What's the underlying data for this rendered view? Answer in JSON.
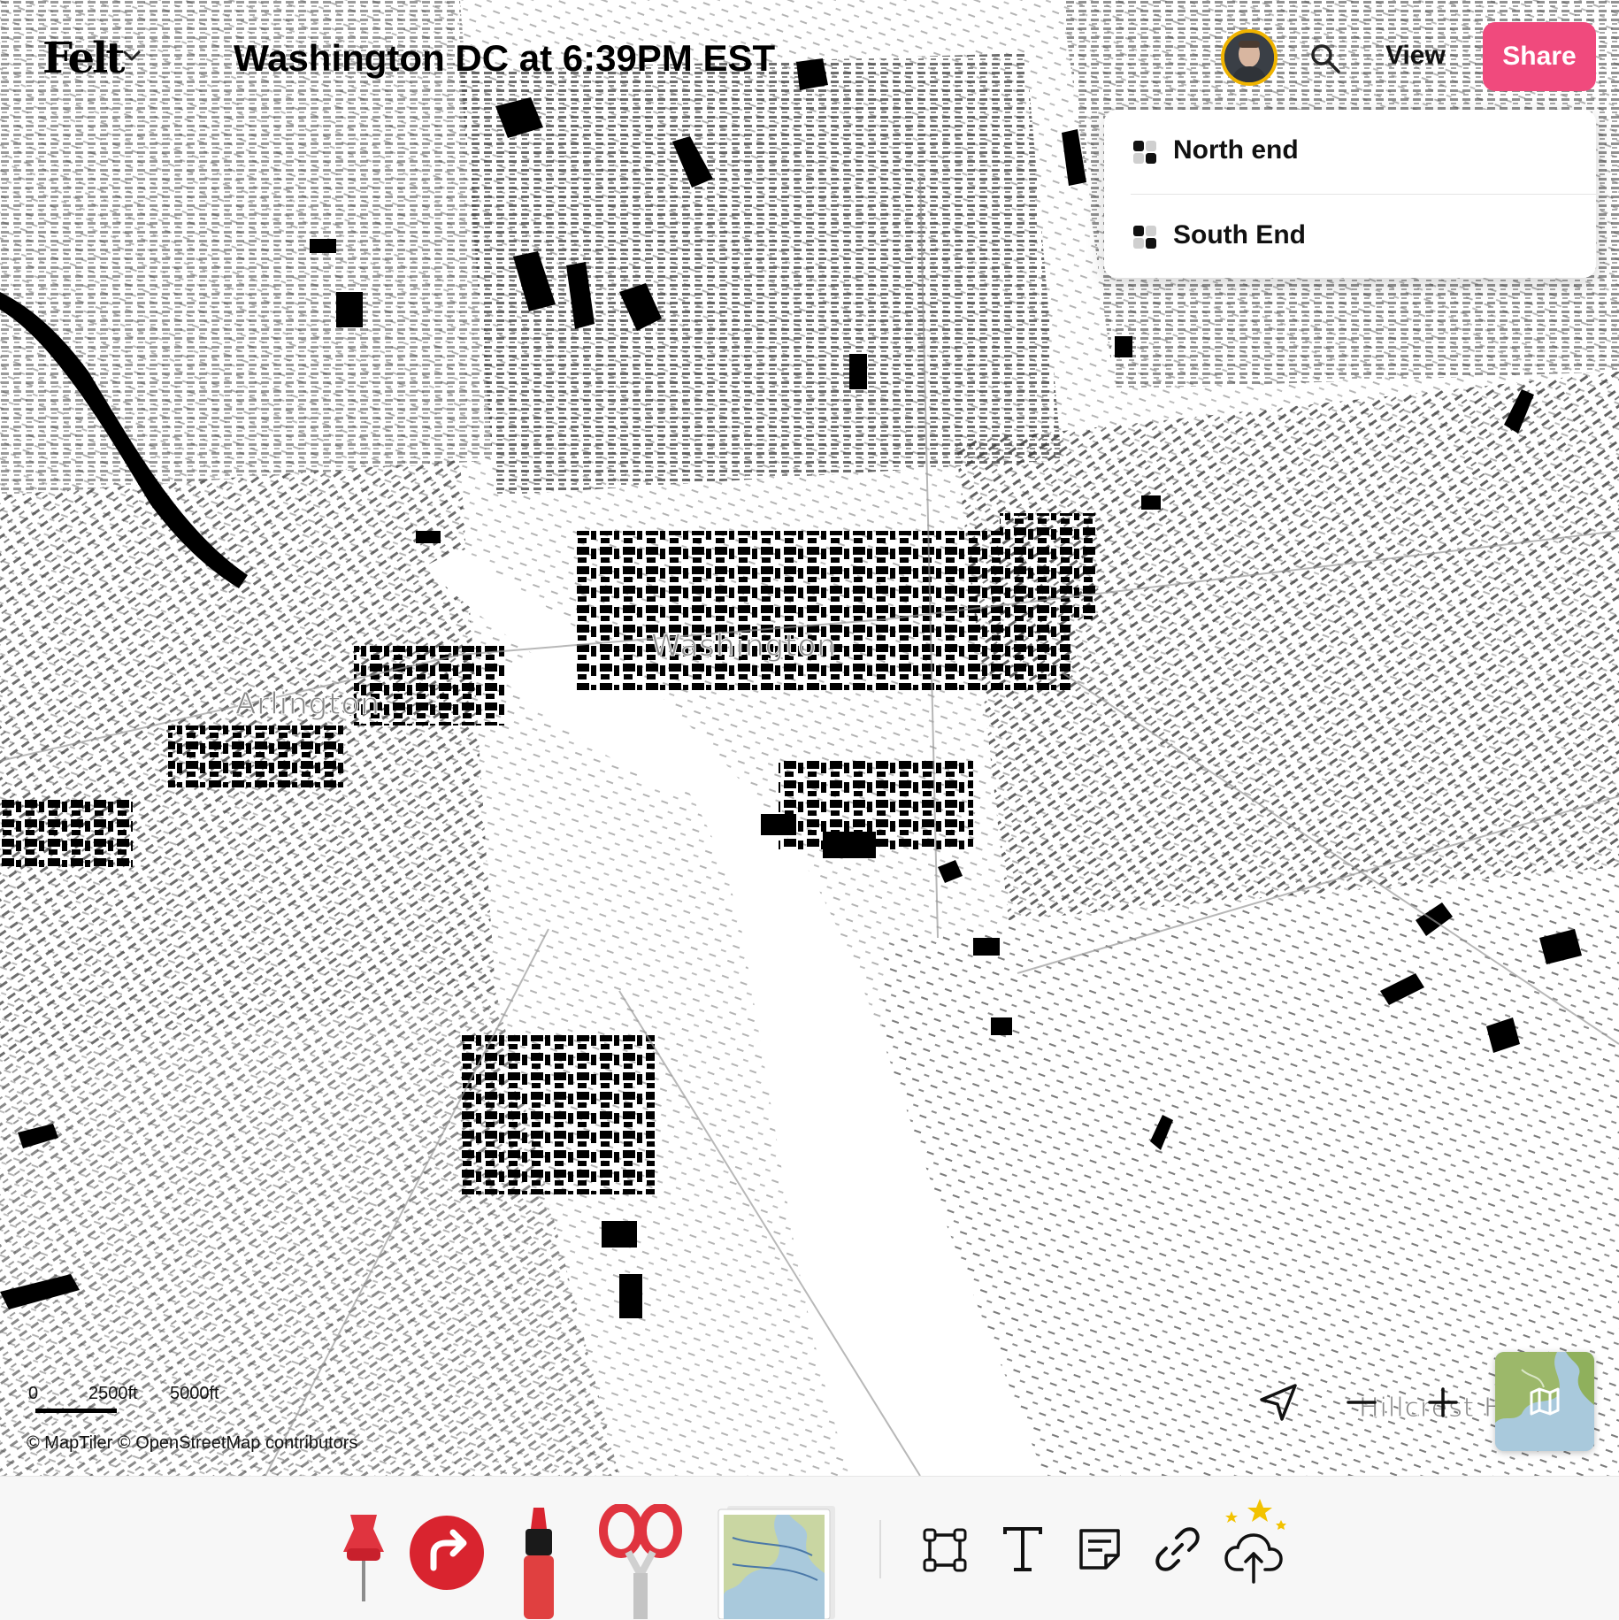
{
  "header": {
    "logo": "Felt",
    "map_title": "Washington DC at 6:39PM EST",
    "view_label": "View",
    "share_label": "Share"
  },
  "view_menu": {
    "items": [
      {
        "label": "North end"
      },
      {
        "label": "South End"
      }
    ]
  },
  "map": {
    "place_labels": [
      "Washington",
      "Arlington",
      "Hillcrest H"
    ],
    "scale_labels": [
      "0",
      "2500ft",
      "5000ft"
    ],
    "attribution": "© MapTiler  © OpenStreetMap contributors"
  },
  "icons": {
    "logo_menu": "chevron-down-icon",
    "search": "search-icon",
    "view_item": "layers-icon",
    "locate": "navigation-arrow-icon",
    "zoom_out": "minus-icon",
    "zoom_in": "plus-icon",
    "basemap": "map-icon",
    "tools": [
      "pin-icon",
      "route-icon",
      "marker-icon",
      "scissors-icon",
      "image-upload-icon",
      "rectangle-icon",
      "text-icon",
      "note-icon",
      "link-icon",
      "cloud-upload-icon"
    ]
  },
  "colors": {
    "share_button": "#f04a7d",
    "avatar_ring": "#f0b400",
    "building_fill": "#000000",
    "map_background": "#ffffff",
    "place_label": "#8a8a8a"
  }
}
